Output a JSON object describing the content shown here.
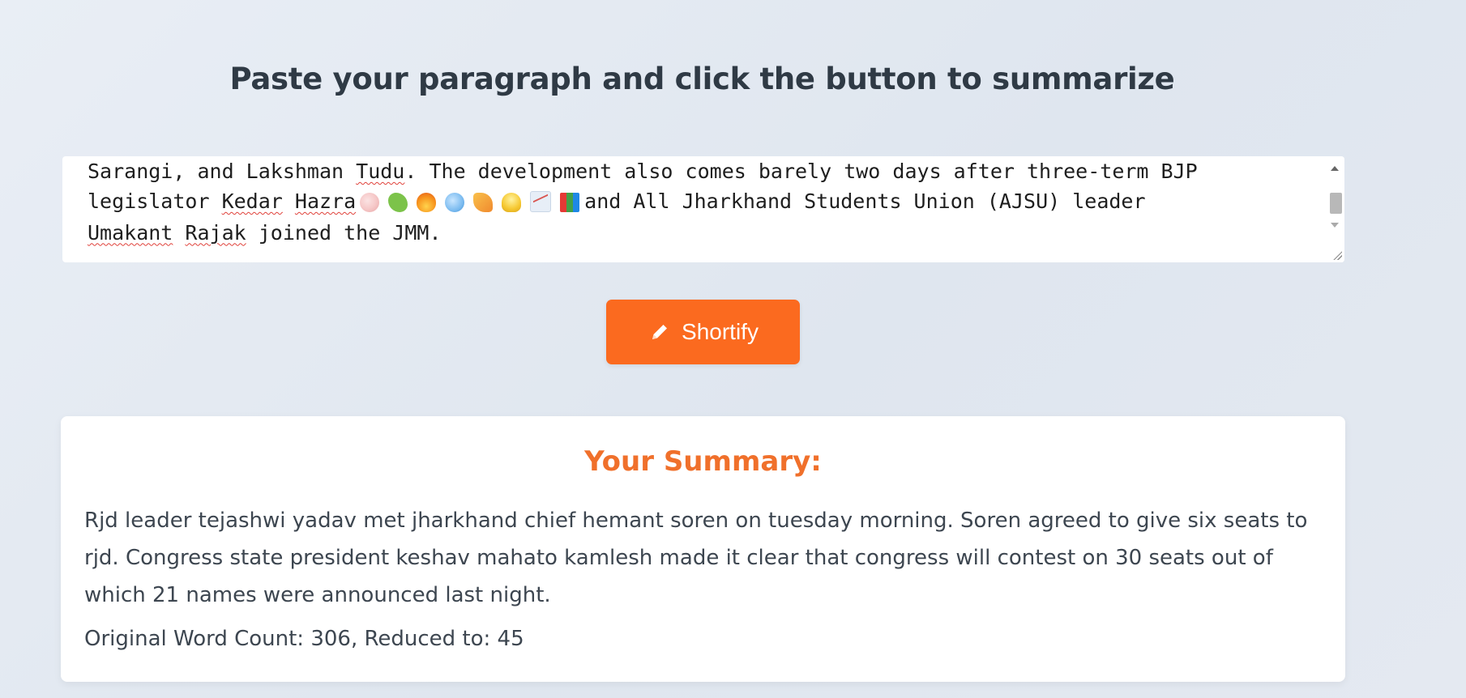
{
  "header": {
    "title": "Paste your paragraph and click the button to summarize"
  },
  "paragraph_input": {
    "line1_a": "Sarangi, and Lakshman ",
    "line1_spell1": "Tudu",
    "line1_b": ". The development also comes barely two days after three-term BJP",
    "line2_a": "legislator ",
    "line2_spell1": "Kedar",
    "line2_gap": " ",
    "line2_spell2": "Hazra",
    "line2_emojis": [
      "palette",
      "clover",
      "fire",
      "globe",
      "pizza",
      "light-bulb",
      "chart",
      "books"
    ],
    "line2_b": "and All Jharkhand Students Union (AJSU) leader",
    "line3_spell1": "Umakant",
    "line3_gap": " ",
    "line3_spell2": "Rajak",
    "line3_b": " joined the JMM."
  },
  "action": {
    "button_label": "Shortify",
    "button_icon": "pencil-icon",
    "button_color": "#fb6a1f"
  },
  "summary": {
    "heading": "Your Summary:",
    "heading_color": "#f0702b",
    "text": "Rjd leader tejashwi yadav met jharkhand chief hemant soren on tuesday morning. Soren agreed to give six seats to rjd. Congress state president keshav mahato kamlesh made it clear that congress will contest on 30 seats out of which 21 names were announced last night.",
    "word_count": "Original Word Count: 306, Reduced to: 45"
  }
}
